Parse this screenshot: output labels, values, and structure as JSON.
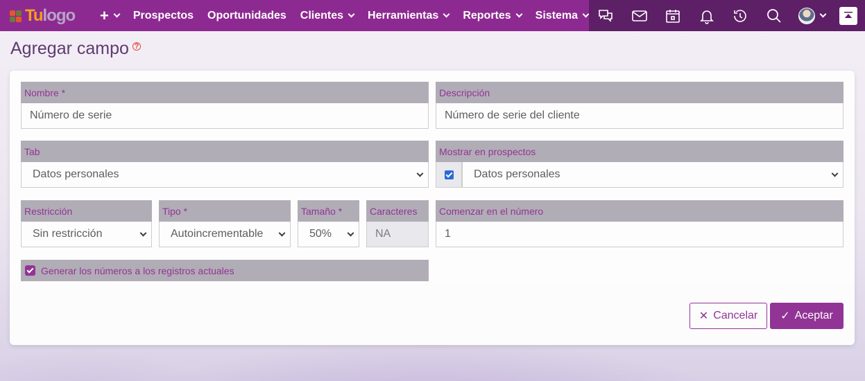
{
  "colors": {
    "brand": "#8d2a91",
    "nav_dark": "#5d1f66",
    "label_bg": "#aeaab3"
  },
  "logo": {
    "part1": "Tu",
    "part2": "logo"
  },
  "nav": {
    "items": [
      "Prospectos",
      "Oportunidades",
      "Clientes",
      "Herramientas",
      "Reportes",
      "Sistema"
    ],
    "icons": [
      "chat-icon",
      "mail-icon",
      "calendar-icon",
      "bell-icon",
      "history-icon",
      "search-icon",
      "avatar",
      "scroll-top-icon"
    ]
  },
  "page": {
    "title": "Agregar campo"
  },
  "form": {
    "nombre": {
      "label": "Nombre *",
      "value": "Número de serie"
    },
    "descripcion": {
      "label": "Descripción",
      "value": "Número de serie del cliente"
    },
    "tab": {
      "label": "Tab",
      "value": "Datos personales"
    },
    "mostrar": {
      "label": "Mostrar en prospectos",
      "value": "Datos personales",
      "checked": true
    },
    "restriccion": {
      "label": "Restricción",
      "value": "Sin restricción"
    },
    "tipo": {
      "label": "Tipo *",
      "value": "Autoincrementable"
    },
    "tamano": {
      "label": "Tamaño *",
      "value": "50%"
    },
    "caracteres": {
      "label": "Caracteres",
      "value": "NA"
    },
    "comenzar": {
      "label": "Comenzar en el número",
      "value": "1"
    },
    "generar": {
      "label": "Generar los números a los registros actuales",
      "checked": true
    }
  },
  "buttons": {
    "cancel": "Cancelar",
    "accept": "Aceptar"
  }
}
